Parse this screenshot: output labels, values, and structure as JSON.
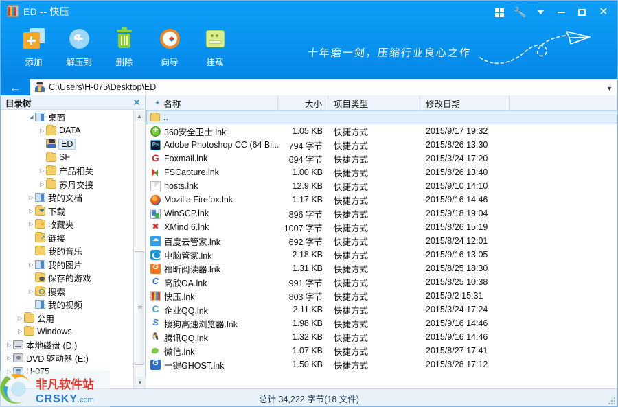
{
  "window": {
    "title": "ED -- 快压",
    "app_icon": "kuaiya-book-icon",
    "controls": [
      {
        "name": "grid-view-button",
        "icon": "grid-icon"
      },
      {
        "name": "settings-button",
        "icon": "wrench-icon"
      },
      {
        "name": "menu-dropdown-button",
        "icon": "chevron-down-icon"
      },
      {
        "name": "minimize-button",
        "icon": "minimize-icon"
      },
      {
        "name": "maximize-button",
        "icon": "maximize-icon"
      },
      {
        "name": "close-button",
        "icon": "close-icon"
      }
    ]
  },
  "toolbar": {
    "buttons": [
      {
        "label": "添加",
        "icon": "add-files-icon"
      },
      {
        "label": "解压到",
        "icon": "extract-to-icon"
      },
      {
        "label": "删除",
        "icon": "trash-icon"
      },
      {
        "label": "向导",
        "icon": "wizard-compass-icon"
      },
      {
        "label": "挂载",
        "icon": "mount-drive-icon"
      }
    ]
  },
  "tagline": "十年磨一剑，压缩行业良心之作",
  "address": {
    "back_label": "←",
    "path": "C:\\Users\\H-075\\Desktop\\ED",
    "dropdown_icon": "chevron-down-icon"
  },
  "tree": {
    "title": "目录树",
    "close_icon": "close-icon",
    "items": [
      {
        "label": "桌面",
        "indent": 2,
        "arrow": "expanded",
        "icon": "folder-desktop"
      },
      {
        "label": "DATA",
        "indent": 3,
        "arrow": "collapsed",
        "icon": "folder-yellow"
      },
      {
        "label": "ED",
        "indent": 3,
        "arrow": "none",
        "icon": "folder-user",
        "selected": true
      },
      {
        "label": "SF",
        "indent": 3,
        "arrow": "none",
        "icon": "folder-yellow"
      },
      {
        "label": "产品相关",
        "indent": 3,
        "arrow": "collapsed",
        "icon": "folder-yellow"
      },
      {
        "label": "苏丹交接",
        "indent": 3,
        "arrow": "collapsed",
        "icon": "folder-yellow"
      },
      {
        "label": "我的文档",
        "indent": 2,
        "arrow": "collapsed",
        "icon": "folder-documents"
      },
      {
        "label": "下载",
        "indent": 2,
        "arrow": "collapsed",
        "icon": "folder-downloads"
      },
      {
        "label": "收藏夹",
        "indent": 2,
        "arrow": "collapsed",
        "icon": "folder-favorites"
      },
      {
        "label": "链接",
        "indent": 2,
        "arrow": "none",
        "icon": "folder-links"
      },
      {
        "label": "我的音乐",
        "indent": 2,
        "arrow": "none",
        "icon": "folder-music"
      },
      {
        "label": "我的图片",
        "indent": 2,
        "arrow": "collapsed",
        "icon": "folder-pictures"
      },
      {
        "label": "保存的游戏",
        "indent": 2,
        "arrow": "none",
        "icon": "folder-games"
      },
      {
        "label": "搜索",
        "indent": 2,
        "arrow": "collapsed",
        "icon": "folder-search"
      },
      {
        "label": "我的视频",
        "indent": 2,
        "arrow": "none",
        "icon": "folder-videos"
      },
      {
        "label": "公用",
        "indent": 1,
        "arrow": "collapsed",
        "icon": "folder-yellow"
      },
      {
        "label": "Windows",
        "indent": 1,
        "arrow": "collapsed",
        "icon": "folder-yellow"
      },
      {
        "label": "本地磁盘 (D:)",
        "indent": 0,
        "arrow": "collapsed",
        "icon": "disk-icon"
      },
      {
        "label": "DVD 驱动器 (E:)",
        "indent": 0,
        "arrow": "collapsed",
        "icon": "dvd-icon"
      },
      {
        "label": "H-075",
        "indent": 0,
        "arrow": "collapsed",
        "icon": "computer-icon"
      }
    ]
  },
  "list": {
    "columns": [
      "名称",
      "大小",
      "项目类型",
      "修改日期"
    ],
    "sort_icon": "sort-ascending-icon",
    "parent_row": {
      "name": "..",
      "icon": "folder-up-icon"
    },
    "rows": [
      {
        "name": "360安全卫士.lnk",
        "size": "1.05 KB",
        "type": "快捷方式",
        "date": "2015/9/17 19:32",
        "icon": "i-360"
      },
      {
        "name": "Adobe Photoshop CC (64 Bi...",
        "size": "794 字节",
        "type": "快捷方式",
        "date": "2015/8/26 13:30",
        "icon": "i-ps"
      },
      {
        "name": "Foxmail.lnk",
        "size": "694 字节",
        "type": "快捷方式",
        "date": "2015/3/24 17:20",
        "icon": "i-fox"
      },
      {
        "name": "FSCapture.lnk",
        "size": "1.00 KB",
        "type": "快捷方式",
        "date": "2015/8/26 13:40",
        "icon": "i-fsc"
      },
      {
        "name": "hosts.lnk",
        "size": "12.9 KB",
        "type": "快捷方式",
        "date": "2015/9/10 14:10",
        "icon": "i-doc"
      },
      {
        "name": "Mozilla Firefox.lnk",
        "size": "1.17 KB",
        "type": "快捷方式",
        "date": "2015/9/16 14:46",
        "icon": "i-ff"
      },
      {
        "name": "WinSCP.lnk",
        "size": "896 字节",
        "type": "快捷方式",
        "date": "2015/9/18 19:04",
        "icon": "i-scp"
      },
      {
        "name": "XMind 6.lnk",
        "size": "1007 字节",
        "type": "快捷方式",
        "date": "2015/8/26 15:19",
        "icon": "i-xm"
      },
      {
        "name": "百度云管家.lnk",
        "size": "692 字节",
        "type": "快捷方式",
        "date": "2015/8/24 12:01",
        "icon": "i-bdy"
      },
      {
        "name": "电脑管家.lnk",
        "size": "2.18 KB",
        "type": "快捷方式",
        "date": "2015/9/16 13:05",
        "icon": "i-pcm"
      },
      {
        "name": "福昕阅读器.lnk",
        "size": "1.31 KB",
        "type": "快捷方式",
        "date": "2015/8/25 18:30",
        "icon": "i-fx"
      },
      {
        "name": "高欣OA.lnk",
        "size": "991 字节",
        "type": "快捷方式",
        "date": "2015/8/25 10:38",
        "icon": "i-gx"
      },
      {
        "name": "快压.lnk",
        "size": "803 字节",
        "type": "快捷方式",
        "date": "2015/9/2 15:31",
        "icon": "i-kz"
      },
      {
        "name": "企业QQ.lnk",
        "size": "2.11 KB",
        "type": "快捷方式",
        "date": "2015/3/24 17:24",
        "icon": "i-qqe"
      },
      {
        "name": "搜狗高速浏览器.lnk",
        "size": "1.98 KB",
        "type": "快捷方式",
        "date": "2015/9/16 14:46",
        "icon": "i-sg"
      },
      {
        "name": "腾讯QQ.lnk",
        "size": "1.32 KB",
        "type": "快捷方式",
        "date": "2015/9/16 14:46",
        "icon": "i-qq"
      },
      {
        "name": "微信.lnk",
        "size": "1.07 KB",
        "type": "快捷方式",
        "date": "2015/8/27 17:41",
        "icon": "i-wx"
      },
      {
        "name": "一键GHOST.lnk",
        "size": "1.50 KB",
        "type": "快捷方式",
        "date": "2015/8/28 17:12",
        "icon": "i-gh"
      }
    ]
  },
  "status": {
    "summary": "总计  34,222 字节(18 文件)"
  },
  "watermark": {
    "cn": "非凡软件站",
    "en": "CRSKY",
    "tld": ".com"
  },
  "colors": {
    "header_top": "#0d9ef7",
    "header_bottom": "#0587e8",
    "selection": "#dfeefb",
    "status_bg": "#e9f1f9"
  }
}
